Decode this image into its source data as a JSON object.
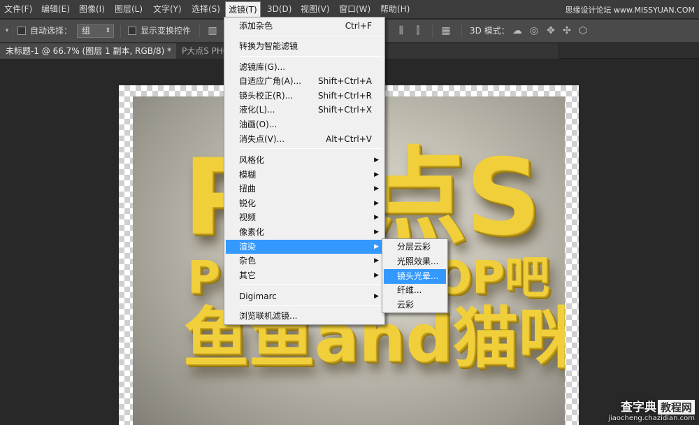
{
  "menubar": {
    "items": [
      "文件(F)",
      "编辑(E)",
      "图像(I)",
      "图层(L)",
      "文字(Y)",
      "选择(S)",
      "滤镜(T)",
      "3D(D)",
      "视图(V)",
      "窗口(W)",
      "帮助(H)"
    ],
    "active": "滤镜(T)",
    "watermark": "思缘设计论坛 www.MISSYUAN.COM"
  },
  "options_bar": {
    "auto_select_label": "自动选择：",
    "auto_select_value": "组",
    "show_transform_label": "显示变换控件",
    "mode_3d_label": "3D 模式："
  },
  "tabs": [
    {
      "label": "未标题-1 @ 66.7% (图层 1 副本, RGB/8) *",
      "close": "×"
    },
    {
      "label": "P大点S PHOTOSHOP吧 鱼鱼and猫咪, RGB/8)",
      "close": "×"
    }
  ],
  "artwork": {
    "line1": "P大点S",
    "line2": "PHOTOSHOP吧",
    "line3": "鱼鱼and猫咪"
  },
  "filter_menu": {
    "items": [
      {
        "label": "添加杂色",
        "shortcut": "Ctrl+F"
      },
      {
        "label": "转换为智能滤镜"
      },
      {
        "label": "滤镜库(G)..."
      },
      {
        "label": "自适应广角(A)...",
        "shortcut": "Shift+Ctrl+A"
      },
      {
        "label": "镜头校正(R)...",
        "shortcut": "Shift+Ctrl+R"
      },
      {
        "label": "液化(L)...",
        "shortcut": "Shift+Ctrl+X"
      },
      {
        "label": "油画(O)..."
      },
      {
        "label": "消失点(V)...",
        "shortcut": "Alt+Ctrl+V"
      },
      {
        "label": "风格化"
      },
      {
        "label": "模糊"
      },
      {
        "label": "扭曲"
      },
      {
        "label": "锐化"
      },
      {
        "label": "视频"
      },
      {
        "label": "像素化"
      },
      {
        "label": "渲染"
      },
      {
        "label": "杂色"
      },
      {
        "label": "其它"
      },
      {
        "label": "Digimarc"
      },
      {
        "label": "浏览联机滤镜..."
      }
    ],
    "highlighted": "渲染"
  },
  "render_submenu": {
    "items": [
      "分层云彩",
      "光照效果...",
      "镜头光晕...",
      "纤维...",
      "云彩"
    ],
    "highlighted": "镜头光晕..."
  },
  "corner_watermark": {
    "brand": "查字典",
    "box": "教程网",
    "url": "jiaocheng.chazidian.com"
  }
}
